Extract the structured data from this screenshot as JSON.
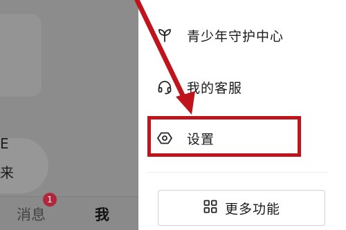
{
  "background_app": {
    "side_text_1": "E",
    "side_text_2": "来",
    "tabbar": {
      "messages_label": "消息",
      "messages_badge": "1",
      "me_label": "我"
    }
  },
  "drawer": {
    "items": [
      {
        "label": "青少年守护中心",
        "icon": "sprout-icon"
      },
      {
        "label": "我的客服",
        "icon": "headset-icon"
      },
      {
        "label": "设置",
        "icon": "settings-hexagon-icon"
      }
    ],
    "more_button": {
      "label": "更多功能",
      "icon": "grid-icon"
    }
  },
  "annotation": {
    "highlight_color": "#c0141c",
    "target": "设置"
  },
  "colors": {
    "dim_overlay": "#8c8c8c",
    "badge": "#b0263a",
    "accent_red": "#c0141c"
  }
}
